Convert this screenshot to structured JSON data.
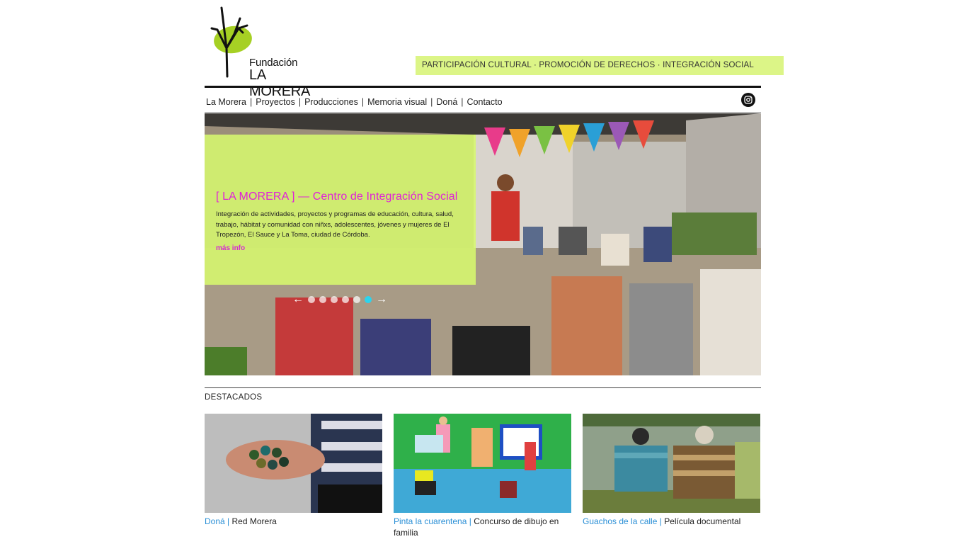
{
  "header": {
    "logo_small": "Fundación",
    "logo_big": "LA MORERA",
    "tagline": "PARTICIPACIÓN CULTURAL · PROMOCIÓN DE DERECHOS · INTEGRACIÓN SOCIAL"
  },
  "nav": {
    "items": [
      {
        "label": "La Morera"
      },
      {
        "label": "Proyectos"
      },
      {
        "label": "Producciones"
      },
      {
        "label": "Memoria visual"
      },
      {
        "label": "Doná"
      },
      {
        "label": "Contacto"
      }
    ],
    "separator": "|",
    "social_icon": "instagram-icon"
  },
  "hero": {
    "title": "[ LA MORERA ] — Centro de Integración Social",
    "text": "Integración de actividades, proyectos y programas de educación, cultura, salud, trabajo, hábitat y comunidad con niñxs, adolescentes, jóvenes y mujeres de El Tropezón, El Sauce y La Toma, ciudad de Córdoba.",
    "more": "más info",
    "slide_count": 6,
    "active_slide": 6,
    "prev_icon": "arrow-left-icon",
    "next_icon": "arrow-right-icon"
  },
  "destacados": {
    "title": "DESTACADOS",
    "cards": [
      {
        "link": "Doná",
        "separator": "|",
        "text": "Red Morera"
      },
      {
        "link": "Pinta la cuarentena",
        "separator": "|",
        "text": "Concurso de dibujo en familia"
      },
      {
        "link": "Guachos de la calle",
        "separator": "|",
        "text": "Película documental"
      }
    ]
  },
  "colors": {
    "tagline_bg": "#dcf587",
    "caption_bg": "#d6f86e",
    "caption_title": "#e020d8",
    "link_blue": "#2a8fd6",
    "active_dot": "#2bd4ee"
  }
}
